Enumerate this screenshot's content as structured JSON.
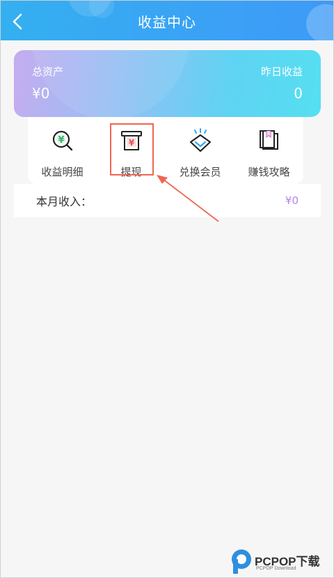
{
  "header": {
    "title": "收益中心",
    "back_icon": "back-chevron-icon"
  },
  "balance_card": {
    "total_assets_label": "总资产",
    "total_assets_value": "¥0",
    "yesterday_income_label": "昨日收益",
    "yesterday_income_value": "0"
  },
  "menu": {
    "items": [
      {
        "label": "收益明细",
        "icon": "income-detail-icon"
      },
      {
        "label": "提现",
        "icon": "withdraw-icon"
      },
      {
        "label": "兑换会员",
        "icon": "diamond-icon"
      },
      {
        "label": "赚钱攻略",
        "icon": "guide-book-icon"
      }
    ]
  },
  "monthly_income": {
    "label": "本月收入：",
    "value": "¥0"
  },
  "watermark": {
    "brand": "PCPOP下载",
    "subtext": "PCPOP Download"
  },
  "colors": {
    "header": "#3aa3f5",
    "annotation": "#ef6650",
    "monthly_value": "#b584e6"
  }
}
